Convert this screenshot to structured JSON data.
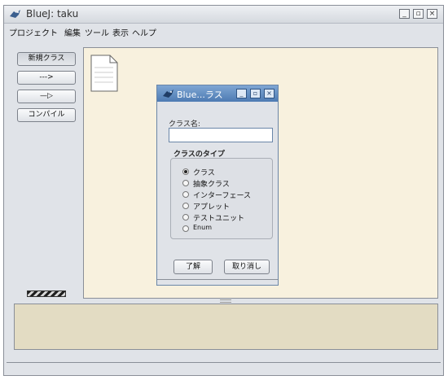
{
  "window": {
    "title": "BlueJ:  taku",
    "controls": [
      "_",
      "▫",
      "×"
    ]
  },
  "menubar": [
    "プロジェクト",
    "編集",
    "ツール",
    "表示",
    "ヘルプ"
  ],
  "toolbar": {
    "new_class": "新規クラス",
    "uses_arrow": "--->",
    "inherits_arrow": "—▷",
    "compile": "コンパイル"
  },
  "dialog": {
    "title": "Blue...ラス",
    "controls": [
      "_",
      "▫",
      "×"
    ],
    "class_name_label": "クラス名:",
    "class_name_value": "",
    "class_type_label": "クラスのタイプ",
    "options": [
      "クラス",
      "抽象クラス",
      "インターフェース",
      "アプレット",
      "テストユニット",
      "Enum"
    ],
    "selected_option": "クラス",
    "ok": "了解",
    "cancel": "取り消し"
  },
  "colors": {
    "canvas": "#f8f1de",
    "bottom_pane": "#e3dcc3",
    "dialog_title": "#5f8bc2"
  }
}
